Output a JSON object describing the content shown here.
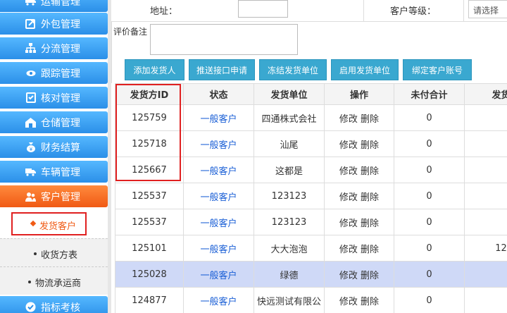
{
  "sidebar": {
    "items": [
      {
        "label": "运输管理",
        "icon": "truck-icon"
      },
      {
        "label": "外包管理",
        "icon": "share-icon"
      },
      {
        "label": "分流管理",
        "icon": "sitemap-icon"
      },
      {
        "label": "跟踪管理",
        "icon": "eye-icon"
      },
      {
        "label": "核对管理",
        "icon": "checklist-icon"
      },
      {
        "label": "仓储管理",
        "icon": "warehouse-icon"
      },
      {
        "label": "财务结算",
        "icon": "money-bag-icon"
      },
      {
        "label": "车辆管理",
        "icon": "truck-icon"
      },
      {
        "label": "客户管理",
        "icon": "users-icon"
      }
    ],
    "sub_items": [
      "发货客户",
      "收货方表",
      "物流承运商"
    ],
    "bottom_item": {
      "label": "指标考核",
      "icon": "check-circle-icon"
    }
  },
  "form": {
    "address_label": "地址：",
    "address_value": "",
    "customer_level_label": "客户等级：",
    "customer_level_select": "请选择",
    "remark_label": "评价备注",
    "remark_value": ""
  },
  "toolbar": [
    "添加发货人",
    "推送接口申请",
    "冻结发货单位",
    "启用发货单位",
    "绑定客户账号"
  ],
  "table": {
    "headers": [
      "发货方ID",
      "状态",
      "发货单位",
      "操作",
      "未付合计",
      "发货"
    ],
    "rows": [
      {
        "id": "125759",
        "status": "一般客户",
        "unit": "四通株式会社",
        "actions": "修改 删除",
        "unpaid": "0",
        "extra": ""
      },
      {
        "id": "125718",
        "status": "一般客户",
        "unit": "汕尾",
        "actions": "修改 删除",
        "unpaid": "0",
        "extra": ""
      },
      {
        "id": "125667",
        "status": "一般客户",
        "unit": "这都是",
        "actions": "修改 删除",
        "unpaid": "0",
        "extra": ""
      },
      {
        "id": "125537",
        "status": "一般客户",
        "unit": "123123",
        "actions": "修改 删除",
        "unpaid": "0",
        "extra": ""
      },
      {
        "id": "125537",
        "status": "一般客户",
        "unit": "123123",
        "actions": "修改 删除",
        "unpaid": "0",
        "extra": ""
      },
      {
        "id": "125101",
        "status": "一般客户",
        "unit": "大大泡泡",
        "actions": "修改 删除",
        "unpaid": "0",
        "extra": "12"
      },
      {
        "id": "125028",
        "status": "一般客户",
        "unit": "绿德",
        "actions": "修改 删除",
        "unpaid": "0",
        "extra": "",
        "highlighted": true
      },
      {
        "id": "124877",
        "status": "一般客户",
        "unit": "快远测试有限公",
        "actions": "修改 删除",
        "unpaid": "0",
        "extra": ""
      }
    ]
  },
  "colors": {
    "nav_blue": "#2b8fe8",
    "nav_active": "#f05a14",
    "button": "#3aa8d0",
    "highlight_row": "#cfd9f7",
    "annotation_red": "#e02020",
    "status_link": "#1a5fd6"
  }
}
